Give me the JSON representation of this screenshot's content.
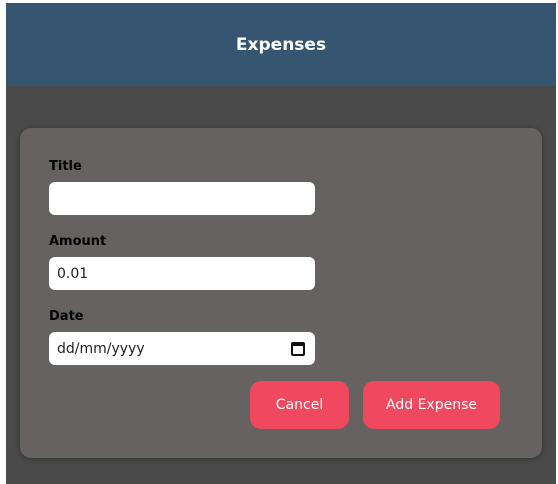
{
  "header": {
    "title": "Expenses"
  },
  "form": {
    "title_label": "Title",
    "title_value": "",
    "amount_label": "Amount",
    "amount_value": "0.01",
    "date_label": "Date",
    "date_placeholder": "dd/mm/yyyy",
    "cancel_label": "Cancel",
    "submit_label": "Add Expense"
  },
  "colors": {
    "header_bg": "#355570",
    "page_bg": "#4a4a4a",
    "panel_bg": "#666262",
    "button_bg": "#f0485e"
  },
  "icons": {
    "date_picker": "calendar-icon"
  }
}
